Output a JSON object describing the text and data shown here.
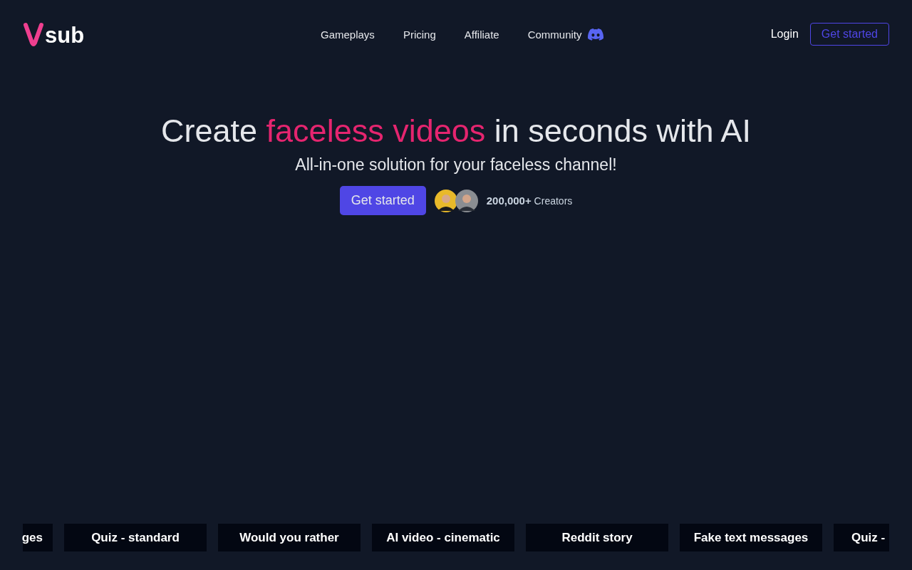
{
  "header": {
    "logo_text": "sub",
    "nav": [
      "Gameplays",
      "Pricing",
      "Affiliate",
      "Community"
    ],
    "login": "Login",
    "cta": "Get started"
  },
  "hero": {
    "title_before": "Create ",
    "title_highlight": "faceless videos",
    "title_after": " in seconds with AI",
    "subtitle": "All-in-one solution for your faceless channel!",
    "cta": "Get started",
    "count": "200,000+",
    "count_label": "Creators"
  },
  "gameplays": [
    {
      "label": "ges",
      "kind": "clipstart"
    },
    {
      "label": "Quiz - standard",
      "kind": "full"
    },
    {
      "label": "Would you rather",
      "kind": "full"
    },
    {
      "label": "AI video - cinematic",
      "kind": "full"
    },
    {
      "label": "Reddit story",
      "kind": "full"
    },
    {
      "label": "Fake text messages",
      "kind": "full"
    },
    {
      "label": "Quiz -",
      "kind": "clipend"
    }
  ]
}
